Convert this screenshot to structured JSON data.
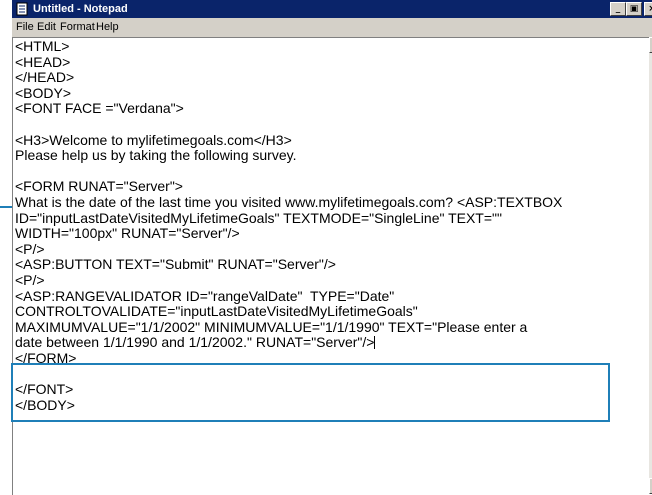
{
  "window": {
    "title": "Untitled - Notepad"
  },
  "menu": [
    "File",
    "Edit",
    "Format",
    "Help"
  ],
  "editor": {
    "lines": [
      "<HTML>",
      "<HEAD>",
      "</HEAD>",
      "<BODY>",
      "<FONT FACE =\"Verdana\">",
      "",
      "<H3>Welcome to mylifetimegoals.com</H3>",
      "Please help us by taking the following survey.",
      "",
      "<FORM RUNAT=\"Server\">",
      "What is the date of the last time you visited www.mylifetimegoals.com? <ASP:TEXTBOX",
      "ID=\"inputLastDateVisitedMyLifetimeGoals\" TEXTMODE=\"SingleLine\" TEXT=\"\"",
      "WIDTH=\"100px\" RUNAT=\"Server\"/>",
      "<P/>",
      "<ASP:BUTTON TEXT=\"Submit\" RUNAT=\"Server\"/>",
      "<P/>",
      "<ASP:RANGEVALIDATOR ID=\"rangeValDate\"  TYPE=\"Date\"",
      "CONTROLTOVALIDATE=\"inputLastDateVisitedMyLifetimeGoals\"",
      "MAXIMUMVALUE=\"1/1/2002\" MINIMUMVALUE=\"1/1/1990\" TEXT=\"Please enter a",
      "date between 1/1/1990 and 1/1/2002.\" RUNAT=\"Server\"/>",
      "</FORM>",
      "",
      "</FONT>",
      "</BODY>"
    ]
  },
  "colors": {
    "titlebar": "#0a246a",
    "callout": "#1f7fb8"
  },
  "icons": {
    "app": "notepad-icon",
    "minimize": "minimize-icon",
    "maximize": "maximize-icon",
    "close": "close-icon"
  }
}
